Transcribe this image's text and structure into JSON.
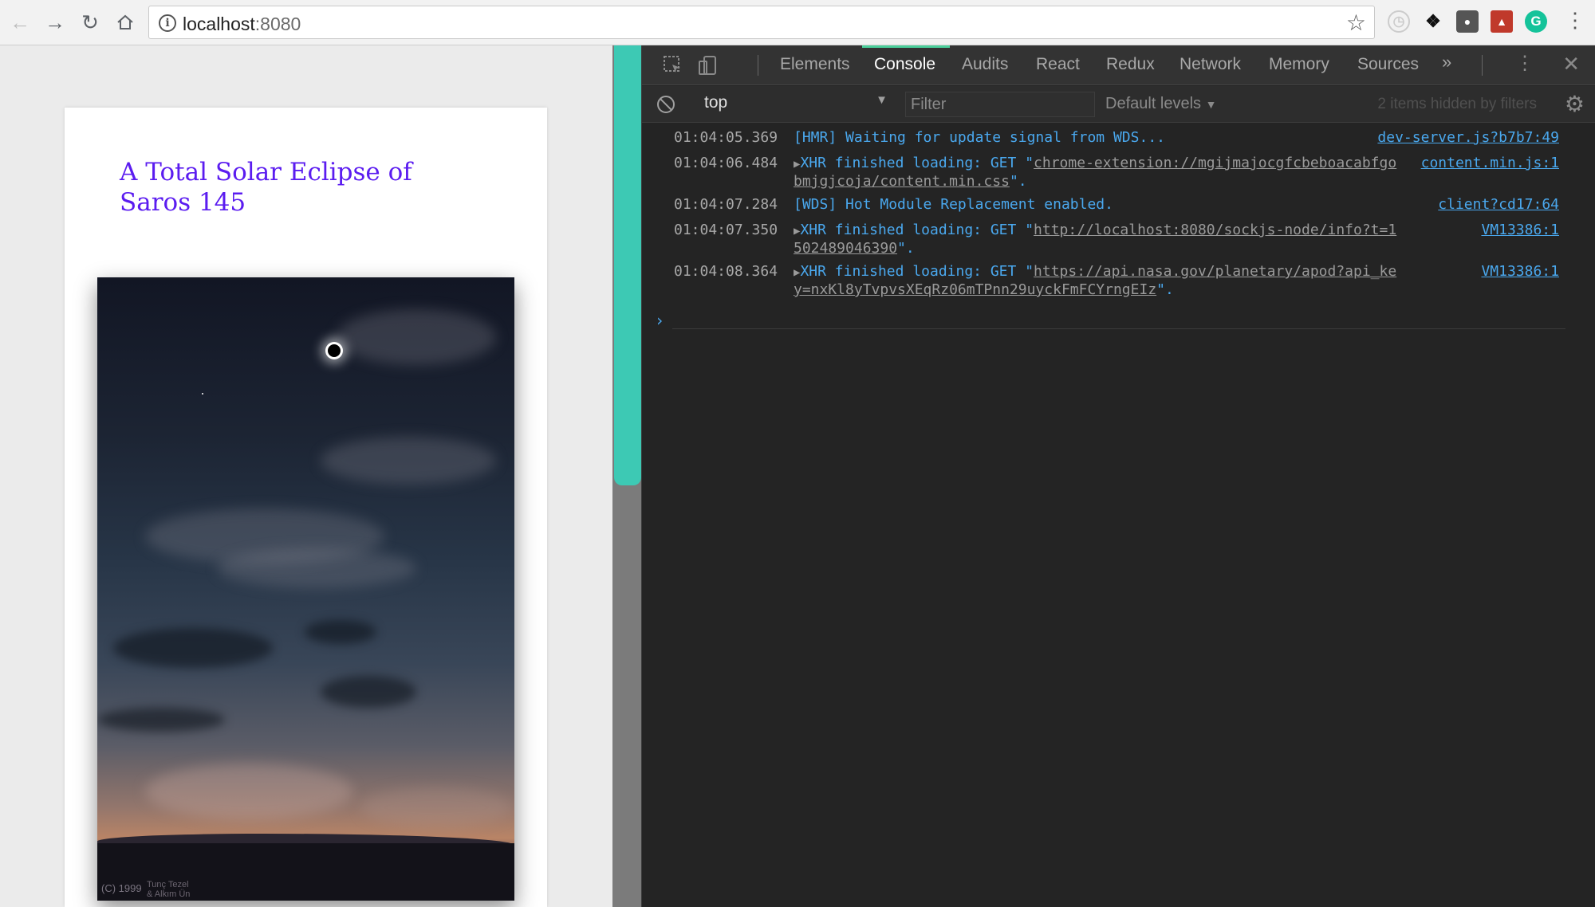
{
  "browser": {
    "url_host": "localhost",
    "url_port": ":8080",
    "back_icon": "arrow-left",
    "forward_icon": "arrow-right",
    "reload_icon": "reload",
    "home_icon": "home",
    "bookmark_icon": "star",
    "extensions": [
      "clock-icon",
      "puffin-icon",
      "lightbulb-icon",
      "bookmark-icon",
      "grammarly-icon"
    ],
    "grammarly_letter": "G"
  },
  "page": {
    "title": "A Total Solar Eclipse of Saros 145",
    "photo_credit_line1": "(C) 1999",
    "photo_credit_line2": "Tunç Tezel",
    "photo_credit_line3": "& Alkım Ün",
    "title_color": "#5b1cf0"
  },
  "devtools": {
    "tabs": [
      "Elements",
      "Console",
      "Audits",
      "React",
      "Redux",
      "Network",
      "Memory",
      "Sources"
    ],
    "active_tab": "Console",
    "more_tabs": "»",
    "context": "top",
    "filter_placeholder": "Filter",
    "levels": "Default levels",
    "hidden_count": "2 items hidden by filters",
    "accent_color": "#4bcf9b",
    "logs": [
      {
        "time": "01:04:05.369",
        "message": "[HMR] Waiting for update signal from WDS...",
        "source": "dev-server.js?b7b7:49"
      },
      {
        "time": "01:04:06.484",
        "prefix": "XHR finished loading: GET \"",
        "link": "chrome-extension://mgijmajocgfcbeboacabfgobmjgjcoja/content.min.css",
        "suffix": "\".",
        "source": "content.min.js:1"
      },
      {
        "time": "01:04:07.284",
        "message": "[WDS] Hot Module Replacement enabled.",
        "source": "client?cd17:64"
      },
      {
        "time": "01:04:07.350",
        "prefix": "XHR finished loading: GET \"",
        "link": "http://localhost:8080/sockjs-node/info?t=1502489046390",
        "suffix": "\".",
        "source": "VM13386:1"
      },
      {
        "time": "01:04:08.364",
        "prefix": "XHR finished loading: GET \"",
        "link": "https://api.nasa.gov/planetary/apod?api_key=nxKl8yTvpvsXEqRz06mTPnn29uyckFmFCYrngEIz",
        "suffix": "\".",
        "source": "VM13386:1"
      }
    ],
    "prompt_symbol": "›"
  }
}
